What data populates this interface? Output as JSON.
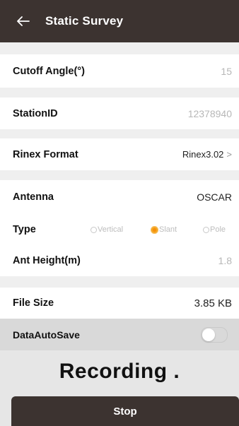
{
  "header": {
    "back_icon": "back-arrow-icon",
    "title": "Static Survey"
  },
  "fields": {
    "cutoff_angle": {
      "label": "Cutoff Angle(°)",
      "value": "15"
    },
    "station_id": {
      "label": "StationID",
      "value": "12378940"
    },
    "rinex_format": {
      "label": "Rinex Format",
      "value": "Rinex3.02",
      "chevron": ">"
    },
    "antenna": {
      "label": "Antenna",
      "value": "OSCAR"
    },
    "type": {
      "label": "Type",
      "options": [
        "Vertical",
        "Slant",
        "Pole"
      ],
      "selected": "Slant"
    },
    "ant_height": {
      "label": "Ant Height(m)",
      "value": "1.8"
    },
    "file_size": {
      "label": "File Size",
      "value": "3.85 KB"
    },
    "data_auto_save": {
      "label": "DataAutoSave",
      "enabled": false
    }
  },
  "status": {
    "text": "Recording ."
  },
  "actions": {
    "stop_label": "Stop"
  },
  "colors": {
    "appbar": "#3c3330",
    "accent_radio": "#f5a623",
    "separator": "#efefef"
  }
}
